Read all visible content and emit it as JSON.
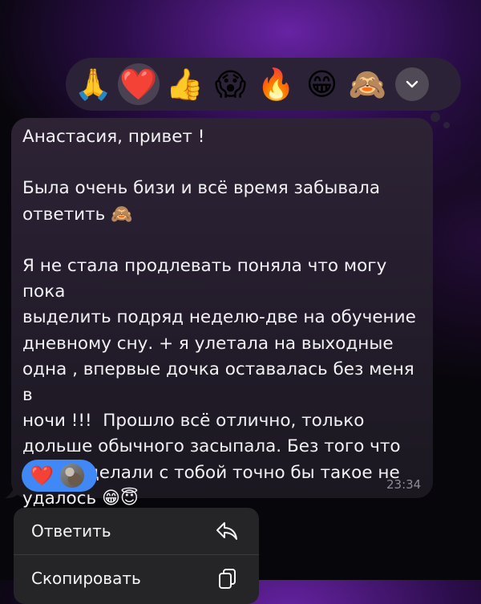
{
  "reactions_bar": {
    "emojis": [
      "🙏",
      "❤️",
      "👍",
      "😱",
      "🔥",
      "😁",
      "🙈"
    ],
    "selected_index": 1,
    "expand_icon": "chevron-down-icon"
  },
  "message": {
    "line1": "Анастасия, привет !",
    "line2": "Была очень бизи и всё время забывала",
    "line3": "ответить",
    "line3_emoji": "🙈",
    "para": "Я не стала продлевать поняла что могу пока\nвыделить подряд неделю-две на обучение\nдневному сну. + я улетала на выходные\nодна , впервые дочка оставалась без меня в\nночи !!!  Прошло всё отлично, только\nдольше обычного засыпала. Без того что\nмы проделали с тобой точно бы такое не\nудалось",
    "end_emojis": "😁😇",
    "reaction": "❤️",
    "time": "23:34"
  },
  "context_menu": {
    "items": [
      {
        "label": "Ответить",
        "icon": "reply-icon"
      },
      {
        "label": "Скопировать",
        "icon": "copy-icon"
      }
    ]
  },
  "colors": {
    "reaction_pill": "#3f88f5",
    "bubble": "#2d2335",
    "menu": "#252528"
  }
}
